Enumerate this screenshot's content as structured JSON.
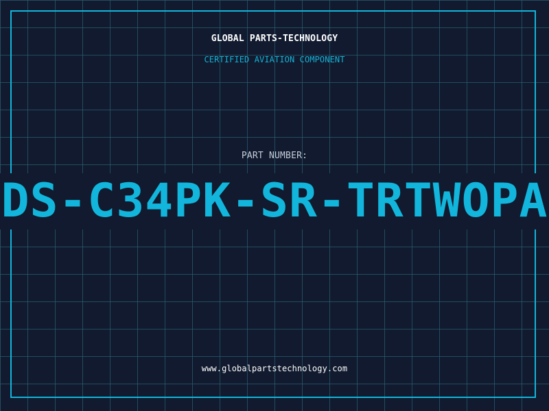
{
  "company": {
    "name": "GLOBAL PARTS-TECHNOLOGY",
    "certification": "CERTIFIED AVIATION COMPONENT"
  },
  "part": {
    "label": "PART NUMBER:",
    "number": "DS-C34PK-SR-TRTWOPA"
  },
  "footer": {
    "url": "www.globalpartstechnology.com"
  },
  "colors": {
    "background": "#111a2e",
    "grid": "#2b5c70",
    "accent": "#12b6dc",
    "text": "#ffffff",
    "muted": "#c7cfdb"
  }
}
